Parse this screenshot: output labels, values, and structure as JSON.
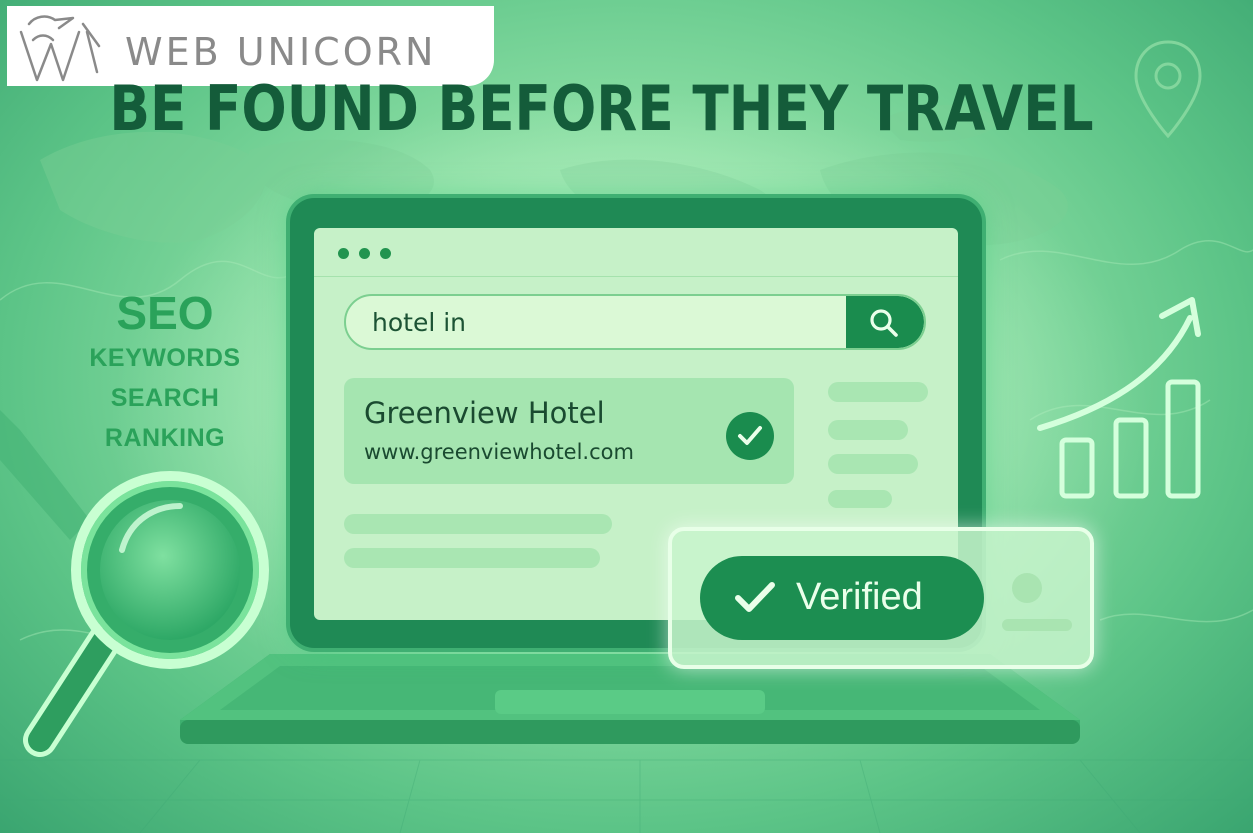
{
  "logo": {
    "text": "WEB UNICORN",
    "icon": "unicorn-w-logo-icon"
  },
  "headline": "BE FOUND BEFORE THEY TRAVEL",
  "side_words": {
    "primary": "SEO",
    "items": [
      "KEYWORDS",
      "SEARCH",
      "RANKING"
    ]
  },
  "browser": {
    "window_dots": 3,
    "search": {
      "query": "hotel in",
      "button_icon": "search-icon"
    },
    "result": {
      "title": "Greenview Hotel",
      "url": "www.greenviewhotel.com",
      "badge_icon": "checkmark-icon"
    }
  },
  "verified": {
    "label": "Verified",
    "icon": "checkmark-icon"
  },
  "decor": {
    "left": "magnifying-glass-icon",
    "right": "growth-chart-icon",
    "top_right": "location-pin-icon",
    "background": "world-map"
  },
  "colors": {
    "headline": "#145c3a",
    "accent": "#1a8c4e",
    "side_text": "#2aa25a",
    "logo_text": "#8a8a8a"
  }
}
